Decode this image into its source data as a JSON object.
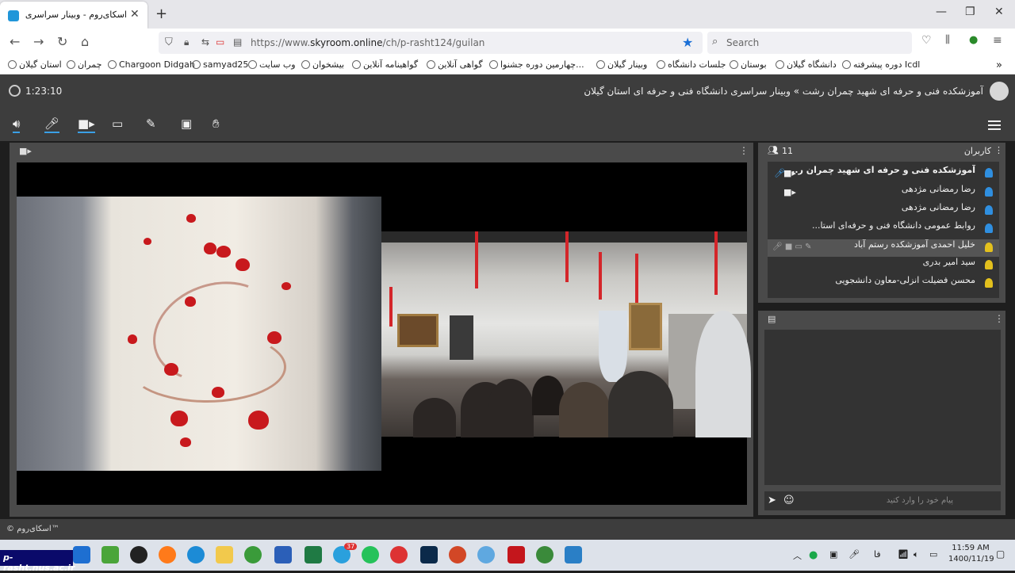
{
  "browser": {
    "tab_title": "اسکای‌روم - وبینار سراسری دانشگاه",
    "url_prefix": "https://www.",
    "url_host": "skyroom.online",
    "url_path": "/ch/p-rasht124/guilan",
    "search_placeholder": "Search",
    "bookmarks": [
      "استان گیلان",
      "چمران",
      "Chargoon Didgah",
      "samyad25",
      "وب سایت",
      "بیشخوان",
      "گواهینامه آنلاین",
      "گواهی آنلاین",
      "چهارمین دوره جشنوا...",
      "وبینار گیلان",
      "جلسات دانشگاه",
      "بوستان",
      "دانشگاه گیلان",
      "دوره پیشرفته Icdl"
    ]
  },
  "app": {
    "timer": "1:23:10",
    "room_title": "آموزشکده فنی و حرفه ای شهید چمران رشت » وبینار سراسری دانشگاه فنی و حرفه ای استان گیلان",
    "users_label": "کاربران",
    "users_count": "11",
    "users": [
      {
        "name": "آموزشکده فنی و حرفه ای شهید چمران ر...",
        "role": "blue",
        "bold": true
      },
      {
        "name": "رضا رمضانی مژدهی",
        "role": "blue",
        "bold": false
      },
      {
        "name": "رضا رمضانی مژدهی",
        "role": "blue",
        "bold": false
      },
      {
        "name": "روابط عمومی دانشگاه فنی و حرفه‌ای استا...",
        "role": "blue",
        "bold": false
      },
      {
        "name": "خلیل احمدی آموزشکده رستم آباد",
        "role": "yellow",
        "bold": false
      },
      {
        "name": "سید امیر بدری",
        "role": "yellow",
        "bold": false
      },
      {
        "name": "محسن فضیلت انزلی-معاون دانشجویی",
        "role": "yellow",
        "bold": false
      }
    ],
    "chat_placeholder": "پیام خود را وارد کنید",
    "footer_brand": "© اسکای‌روم™"
  },
  "taskbar": {
    "time": "11:59 AM",
    "date": "1400/11/19",
    "lang": "فا",
    "watermark": "p-rasht.nus.ac.ir",
    "badge": "37"
  },
  "colors": {
    "accent": "#3aa0e6",
    "panel": "#4a4a4a",
    "header": "#3d3d3d",
    "user_blue": "#2f8fe0",
    "user_yellow": "#e3c01d"
  }
}
